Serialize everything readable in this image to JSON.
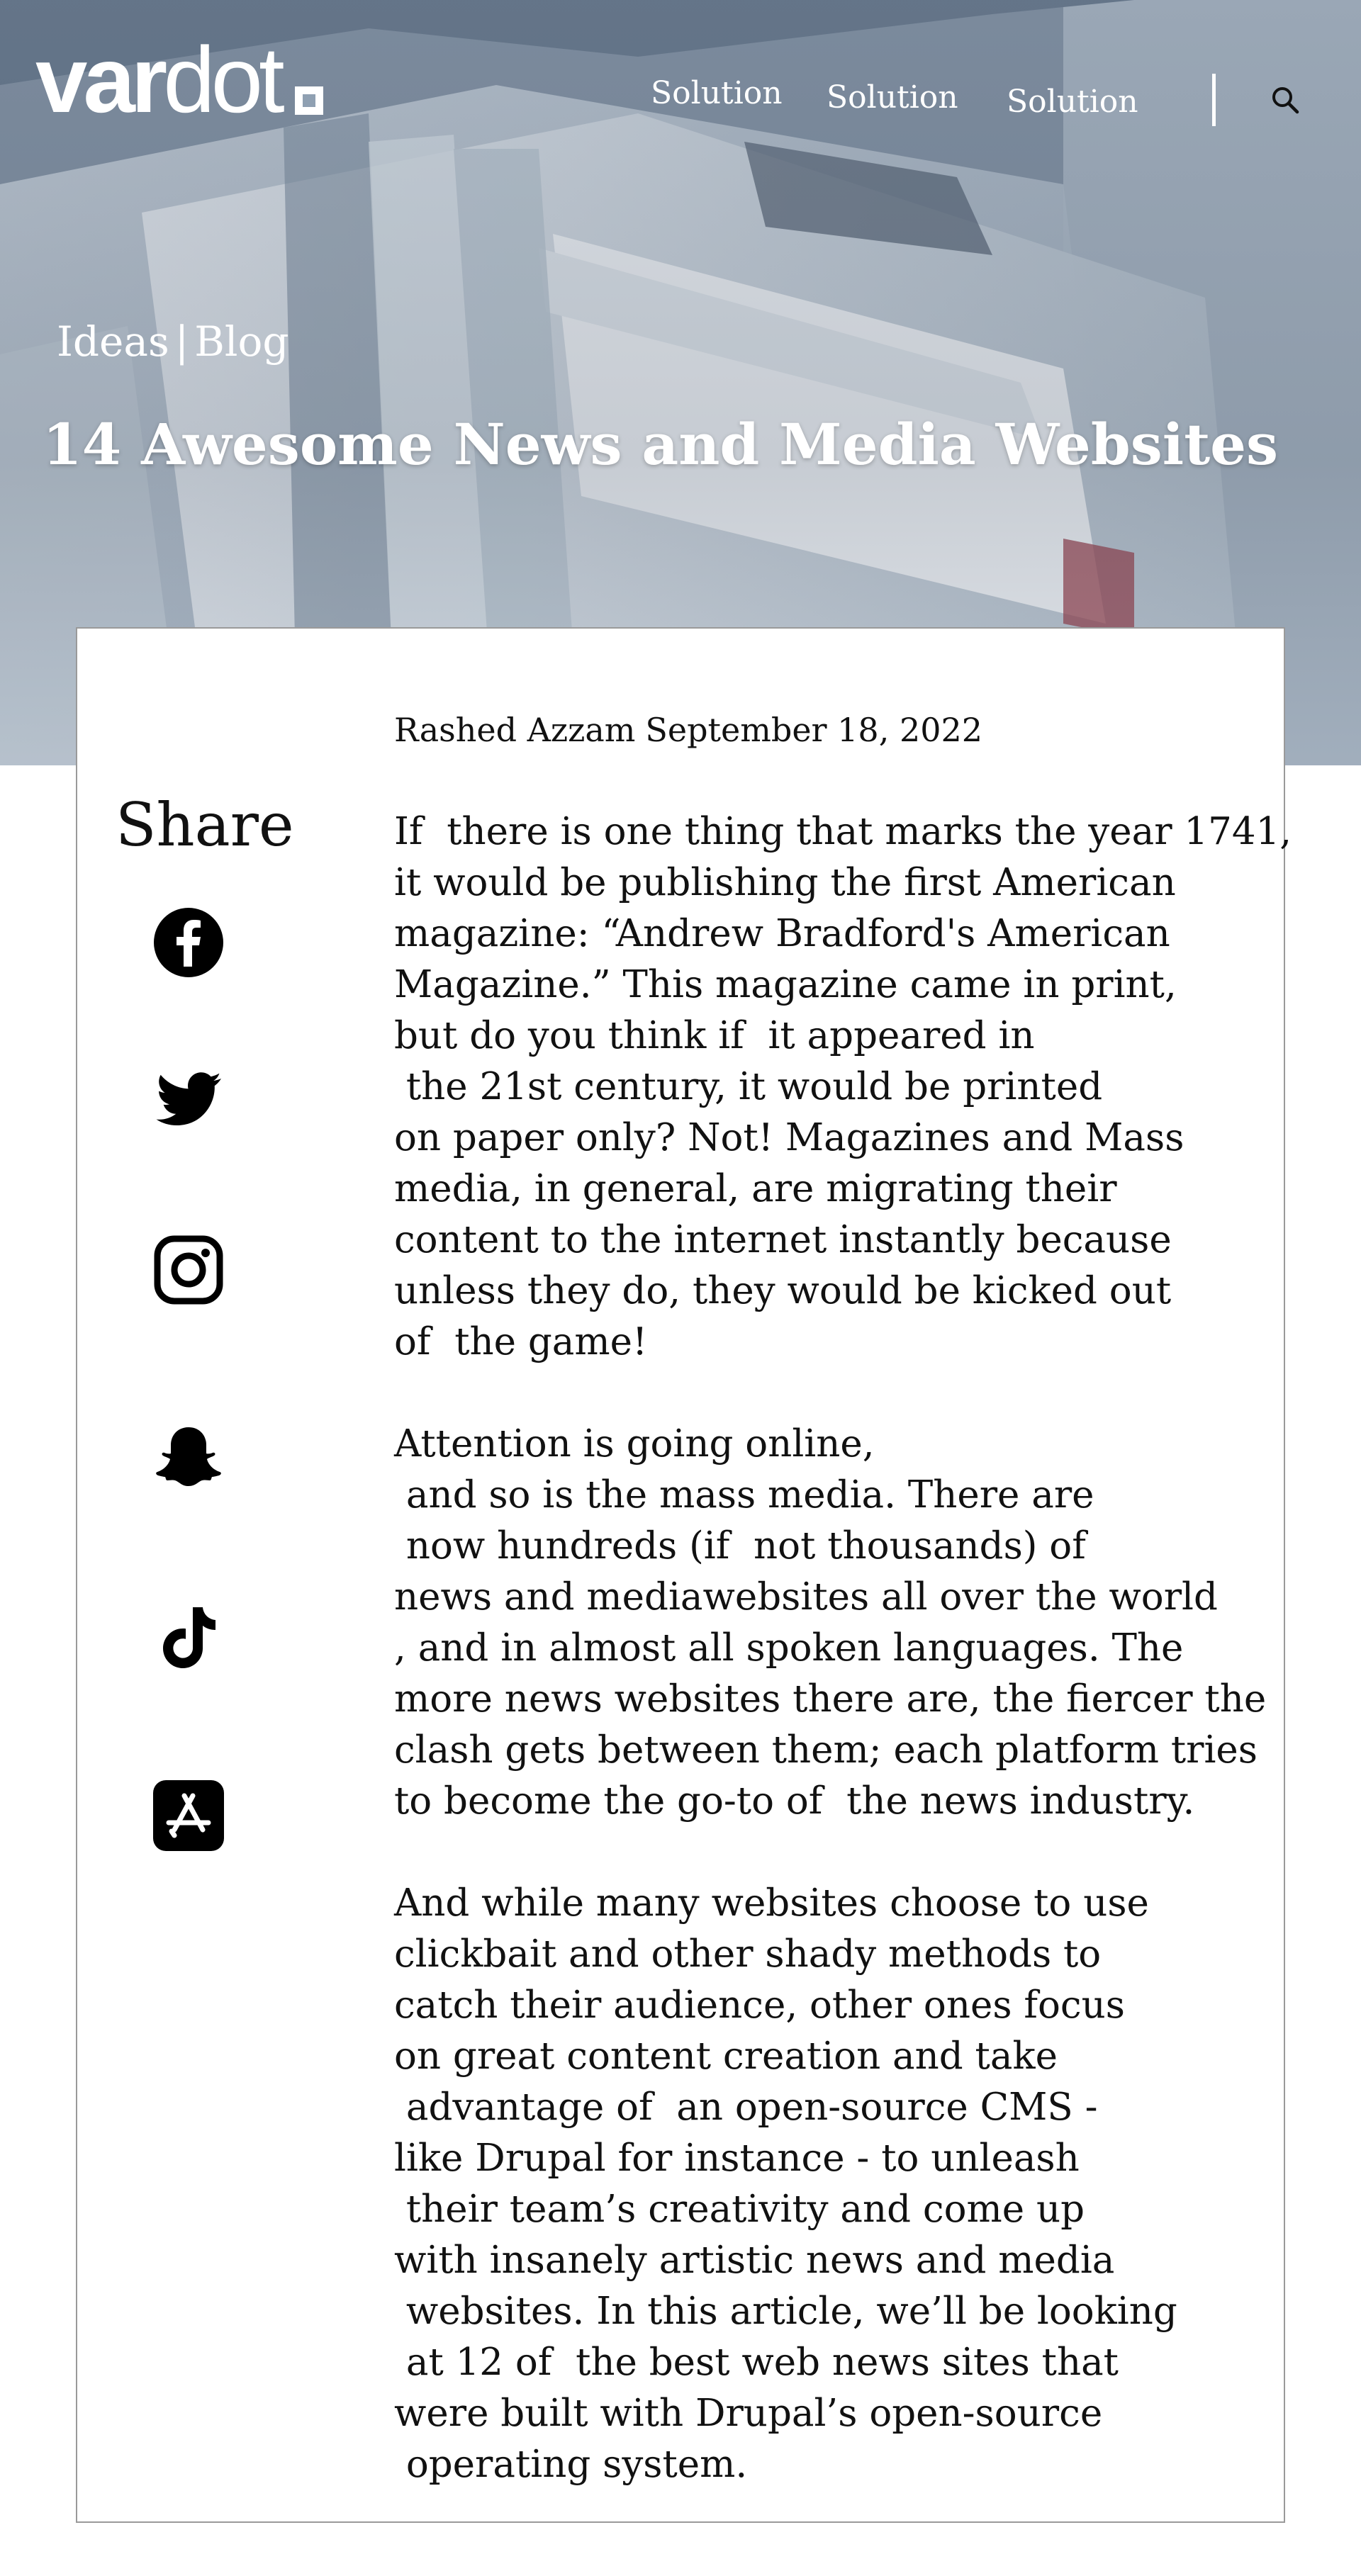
{
  "header": {
    "logo_text_bold": "var",
    "logo_text_thin": "dot",
    "nav": [
      {
        "label": "Solution"
      },
      {
        "label": "Solution"
      },
      {
        "label": "Solution"
      }
    ],
    "search_icon": "search-icon"
  },
  "hero": {
    "breadcrumb": {
      "section": "Ideas",
      "separator": "|",
      "page": "Blog"
    },
    "title": "14 Awesome News and Media Websites"
  },
  "article": {
    "author": "Rashed Azzam",
    "date": "September 18, 2022",
    "paragraphs": [
      {
        "lines": [
          "If  there is one thing that marks the year 1741,",
          "it would be publishing the first American",
          "magazine: “Andrew Bradford's American",
          "Magazine.” This magazine came in print,",
          "but do you think if  it appeared in",
          " the 21st century, it would be printed",
          "on paper only? Not! Magazines and Mass",
          "media, in general, are migrating their",
          "content to the internet instantly because",
          "unless they do, they would be kicked out",
          "of  the game!"
        ]
      },
      {
        "lines": [
          "Attention is going online,",
          " and so is the mass media. There are",
          " now hundreds (if  not thousands) of",
          "news and mediawebsites all over the world",
          ", and in almost all spoken languages. The",
          "more news websites there are, the fiercer the",
          "clash gets between them; each platform tries",
          "to become the go-to of  the news industry."
        ]
      },
      {
        "lines": [
          "And while many websites choose to use",
          "clickbait and other shady methods to",
          "catch their audience, other ones focus",
          "on great content creation and take",
          " advantage of  an open-source CMS -",
          "like Drupal for instance - to unleash",
          " their team’s creativity and come up",
          "with insanely artistic news and media",
          " websites. In this article, we’ll be looking",
          " at 12 of  the best web news sites that",
          "were built with Drupal’s open-source",
          " operating system."
        ]
      }
    ]
  },
  "share": {
    "title": "Share",
    "items": [
      {
        "icon": "facebook-icon"
      },
      {
        "icon": "twitter-icon"
      },
      {
        "icon": "instagram-icon"
      },
      {
        "icon": "snapchat-icon"
      },
      {
        "icon": "tiktok-icon"
      },
      {
        "icon": "app-store-icon"
      }
    ]
  },
  "colors": {
    "hero_tint": "#8a9aad",
    "text": "#111111",
    "card_border": "#9a9a9a",
    "white": "#ffffff"
  }
}
